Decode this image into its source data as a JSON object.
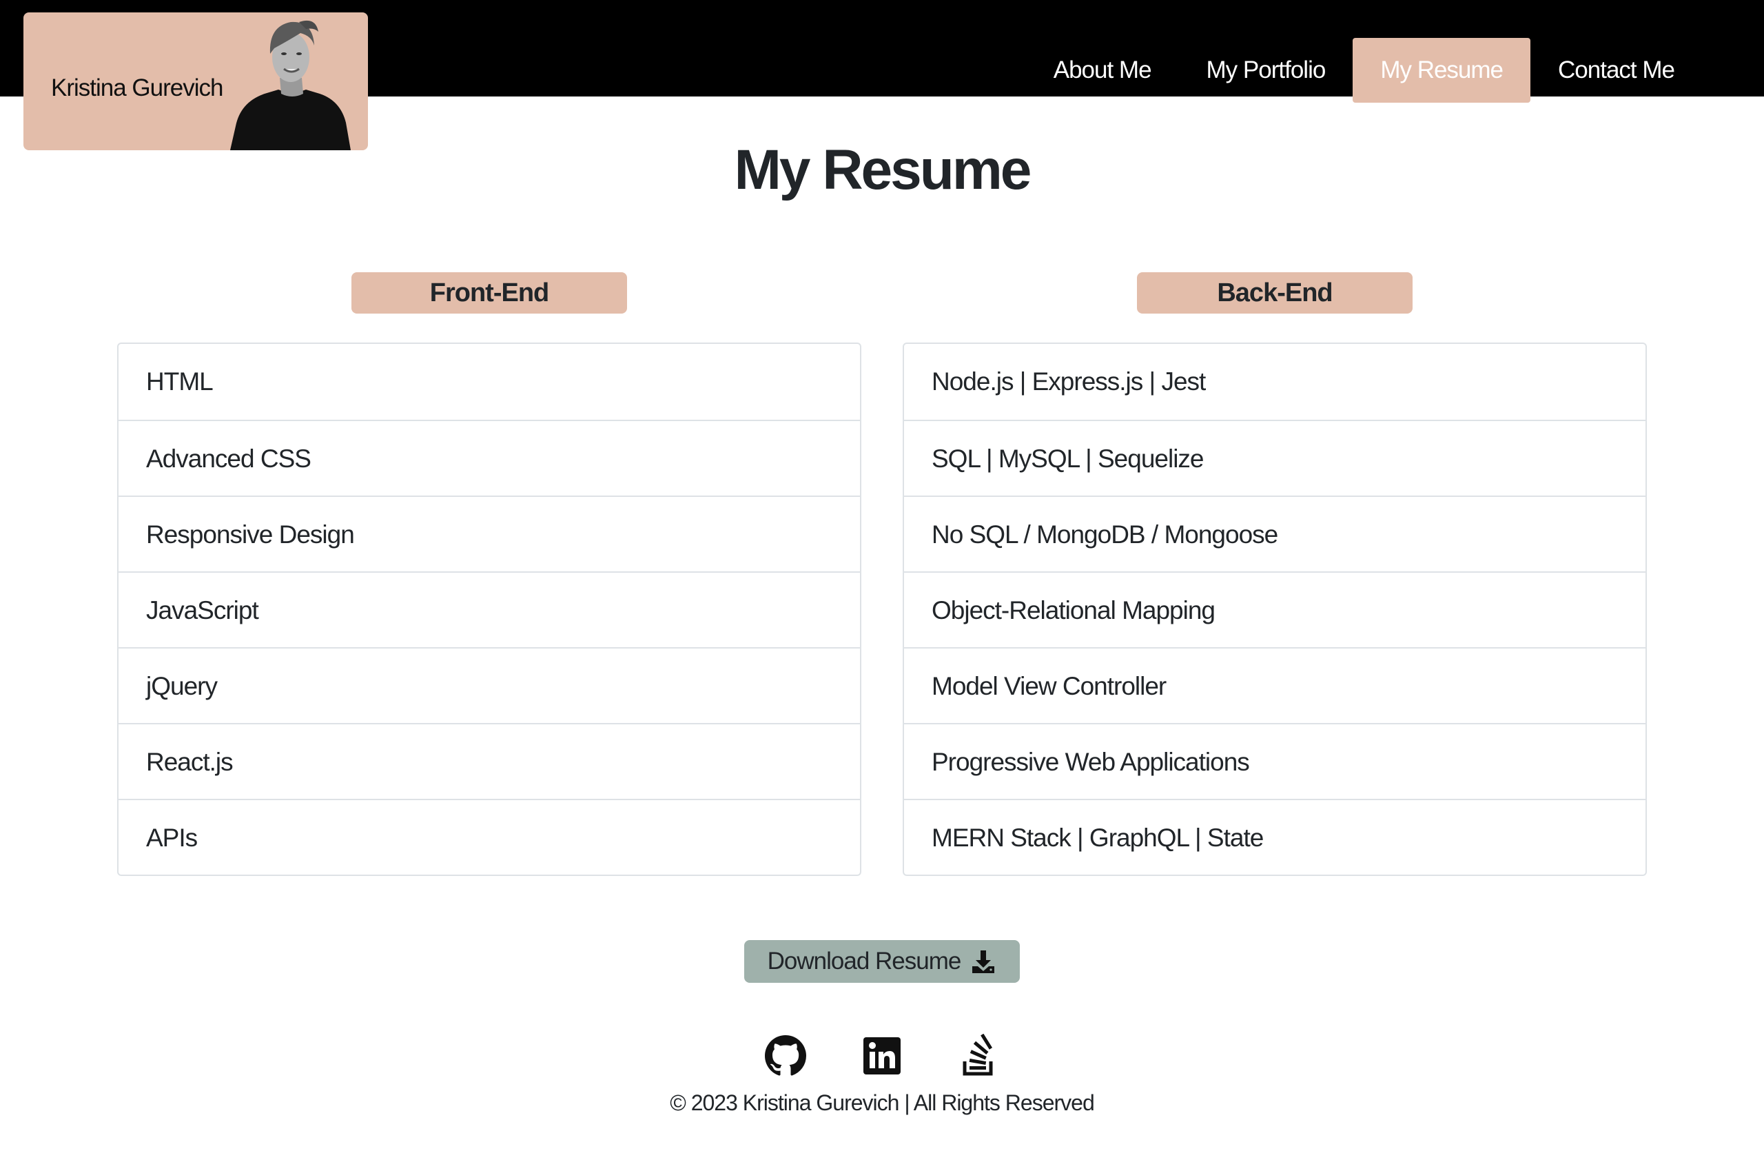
{
  "brand": {
    "name": "Kristina Gurevich",
    "color": "#e3bdaa"
  },
  "nav": {
    "items": [
      {
        "label": "About Me"
      },
      {
        "label": "My Portfolio"
      },
      {
        "label": "My Resume"
      },
      {
        "label": "Contact Me"
      }
    ],
    "active": "My Resume"
  },
  "page": {
    "title": "My Resume"
  },
  "frontend": {
    "title": "Front-End",
    "items": [
      "HTML",
      "Advanced CSS",
      "Responsive Design",
      "JavaScript",
      "jQuery",
      "React.js",
      "APIs"
    ]
  },
  "backend": {
    "title": "Back-End",
    "items": [
      "Node.js | Express.js | Jest",
      "SQL | MySQL | Sequelize",
      "No SQL / MongoDB / Mongoose",
      "Object-Relational Mapping",
      "Model View Controller",
      "Progressive Web Applications",
      "MERN Stack | GraphQL | State"
    ]
  },
  "download": {
    "label": "Download Resume",
    "icon": "download-icon",
    "color": "#9fb1ab"
  },
  "socials": [
    {
      "icon": "github-icon"
    },
    {
      "icon": "linkedin-icon"
    },
    {
      "icon": "stackoverflow-icon"
    }
  ],
  "footer": {
    "text": "© 2023 Kristina Gurevich | All Rights Reserved"
  }
}
